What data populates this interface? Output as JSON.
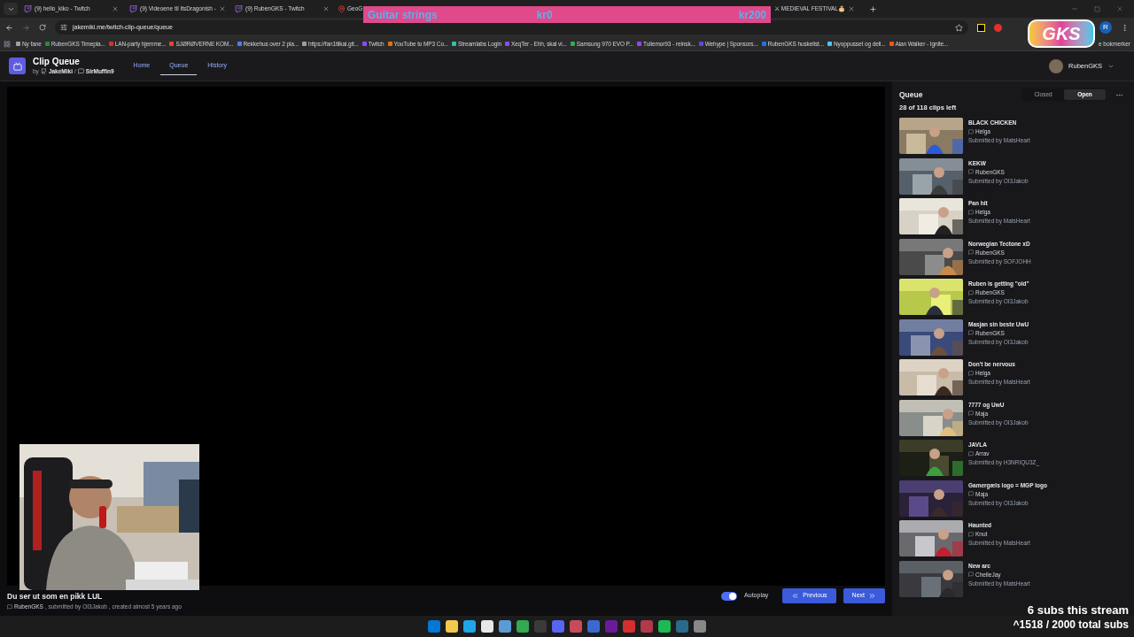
{
  "browser": {
    "tabs": [
      {
        "title": "(9) hello_kiko - Twitch",
        "kind": "twitch"
      },
      {
        "title": "(9) Videoene til ItsDragonish -",
        "kind": "twitch"
      },
      {
        "title": "(9) RubenGKS - Twitch",
        "kind": "twitch"
      },
      {
        "title": "GeoG",
        "kind": "pin"
      },
      {
        "title": "⚔ MEDIEVAL FESTIVAL🎂"
      }
    ],
    "url": "jakemiki.me/twitch-clip-queue/queue",
    "profile": "R",
    "bookmarks": [
      "Ny fane",
      "RubenGKS Timepla...",
      "LAN-party hjemme...",
      "SJØRØVERNE KOM...",
      "Rekkehus over 2 pla...",
      "https://fan1tilkai.git...",
      "Twitch",
      "YouTube to MP3 Co...",
      "Streamlabs Login",
      "XeqTer - Ehh, skal vi...",
      "Samsung 970 EVO P...",
      "Tuliemor93 - reinsk...",
      "Wehype | Sponsors...",
      "RubenGKS huskelist...",
      "Nyoppusset og deli...",
      "Alan Walker - Ignite..."
    ],
    "bookmarks_more": "e bokmerker"
  },
  "overlays": {
    "goal": {
      "label": "Guitar strings",
      "start": "kr0",
      "end": "kr200"
    },
    "logo": "GKS",
    "subs_stream": "6 subs this stream",
    "subs_total": "^1518 / 2000 total subs"
  },
  "app": {
    "title": "Clip Queue",
    "by": "by",
    "author": "JakeMiki",
    "separator": "/",
    "coauthor": "SirMuffin9",
    "nav": [
      {
        "label": "Home",
        "selected": false
      },
      {
        "label": "Queue",
        "selected": true
      },
      {
        "label": "History",
        "selected": false
      }
    ],
    "user": "RubenGKS"
  },
  "player": {
    "title": "Du ser ut som en pikk LUL",
    "channel": "RubenGKS",
    "details": ", submitted by OI3Jakob , created almost 5 years ago",
    "autoplay": {
      "label": "Autoplay",
      "on": true
    },
    "buttons": [
      {
        "label": "Previous",
        "kind": "previous"
      },
      {
        "label": "Next",
        "kind": "next"
      }
    ]
  },
  "queue": {
    "title": "Queue",
    "toggle": [
      {
        "label": "Closed",
        "selected": false
      },
      {
        "label": "Open",
        "selected": true
      }
    ],
    "count": "28 of 118 clips left",
    "clips": [
      {
        "title": "BLACK CHICKEN",
        "channel": "Helga",
        "submitter": "Submitted by MatsHeart"
      },
      {
        "title": "KEKW",
        "channel": "RubenGKS",
        "submitter": "Submitted by OI3Jakob"
      },
      {
        "title": "Pan hit",
        "channel": "Helga",
        "submitter": "Submitted by MatsHeart"
      },
      {
        "title": "Norwegian Tectone xD",
        "channel": "RubenGKS",
        "submitter": "Submitted by SOFJOHH"
      },
      {
        "title": "Ruben is getting \"old\"",
        "channel": "RubenGKS",
        "submitter": "Submitted by OI3Jakob"
      },
      {
        "title": "Masjan sin beste UwU",
        "channel": "RubenGKS",
        "submitter": "Submitted by OI3Jakob"
      },
      {
        "title": "Don't be nervous",
        "channel": "Helga",
        "submitter": "Submitted by MatsHeart"
      },
      {
        "title": "7777 og UwU",
        "channel": "Maja",
        "submitter": "Submitted by OI3Jakob"
      },
      {
        "title": "JAVLA",
        "channel": "Arrav",
        "submitter": "Submitted by H3NRIQU3Z_"
      },
      {
        "title": "Gamergæls logo = MGP logo",
        "channel": "Maja",
        "submitter": "Submitted by OI3Jakob"
      },
      {
        "title": "Haunted",
        "channel": "Knut",
        "submitter": "Submitted by MatsHeart"
      },
      {
        "title": "New arc",
        "channel": "ChelleJay",
        "submitter": "Submitted by MatsHeart"
      }
    ]
  }
}
